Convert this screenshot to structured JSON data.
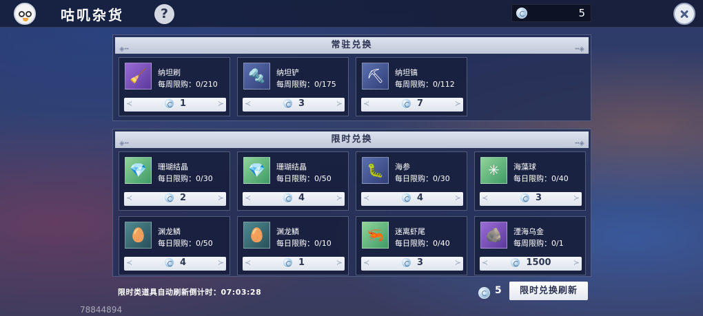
{
  "header": {
    "title": "咕叽杂货",
    "help_label": "?",
    "currency_amount": "5"
  },
  "sections": {
    "permanent": {
      "title": "常驻兑换",
      "items": [
        {
          "name": "纳坦刷",
          "limit_label": "每周限购：",
          "limit_value": "0/210",
          "price": "1",
          "icon": "brush-icon"
        },
        {
          "name": "纳坦铲",
          "limit_label": "每周限购：",
          "limit_value": "0/175",
          "price": "3",
          "icon": "shovel-icon"
        },
        {
          "name": "纳坦镐",
          "limit_label": "每周限购：",
          "limit_value": "0/112",
          "price": "7",
          "icon": "pickaxe-icon"
        }
      ]
    },
    "limited": {
      "title": "限时兑换",
      "items": [
        {
          "name": "珊瑚结晶",
          "limit_label": "每日限购：",
          "limit_value": "0/30",
          "price": "2",
          "icon": "coral-crystal-icon"
        },
        {
          "name": "珊瑚结晶",
          "limit_label": "每日限购：",
          "limit_value": "0/50",
          "price": "4",
          "icon": "coral-crystal-icon"
        },
        {
          "name": "海参",
          "limit_label": "每日限购：",
          "limit_value": "0/30",
          "price": "4",
          "icon": "sea-cucumber-icon"
        },
        {
          "name": "海藻球",
          "limit_label": "每日限购：",
          "limit_value": "0/40",
          "price": "3",
          "icon": "seaweed-ball-icon"
        },
        {
          "name": "渊龙鳞",
          "limit_label": "每日限购：",
          "limit_value": "0/50",
          "price": "4",
          "icon": "dragon-scale-icon"
        },
        {
          "name": "渊龙鳞",
          "limit_label": "每日限购：",
          "limit_value": "0/10",
          "price": "1",
          "icon": "dragon-scale-icon"
        },
        {
          "name": "迷离虾尾",
          "limit_label": "每日限购：",
          "limit_value": "0/40",
          "price": "3",
          "icon": "shrimp-tail-icon"
        },
        {
          "name": "湮海乌金",
          "limit_label": "每周限购：",
          "limit_value": "0/1",
          "price": "1500",
          "icon": "dark-ore-icon"
        }
      ]
    }
  },
  "footer": {
    "countdown_label": "限时类道具自动刷新倒计时：",
    "countdown_value": "07:03:28",
    "refresh_cost": "5",
    "refresh_button": "限时兑换刷新"
  },
  "uid": "78844894"
}
